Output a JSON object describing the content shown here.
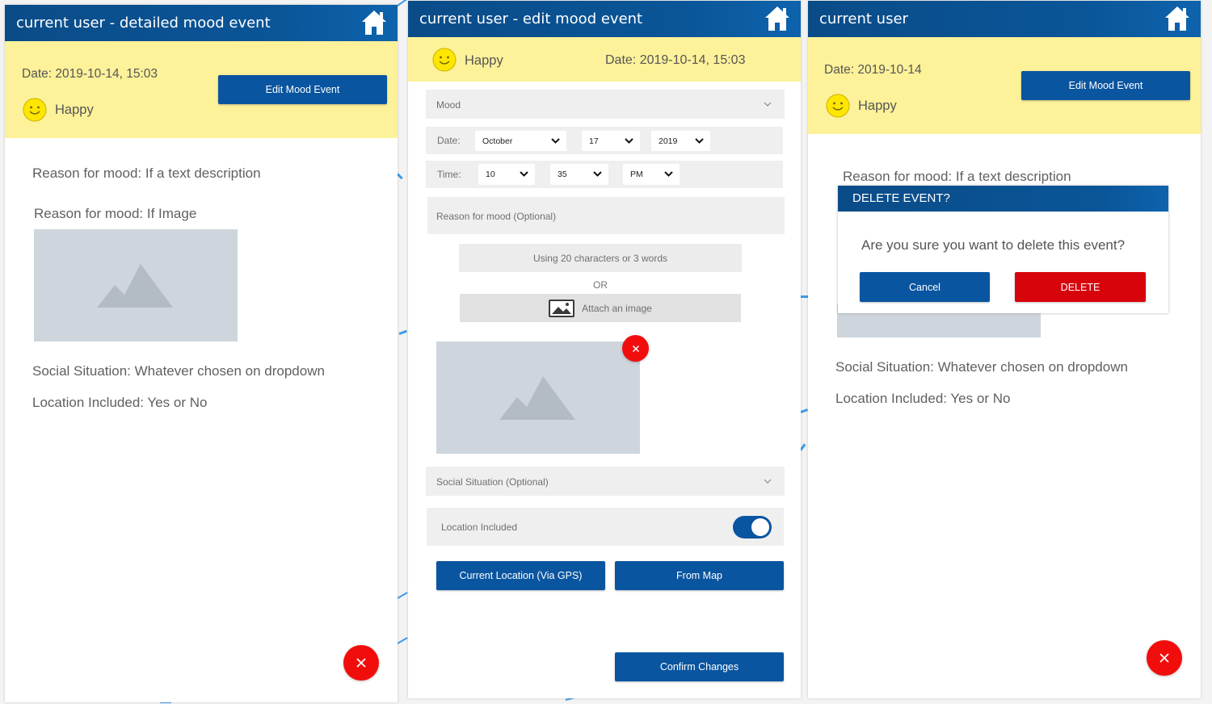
{
  "colors": {
    "header": "#0a5598",
    "accent": "#0a55a0",
    "danger": "#d8040c",
    "yellow": "#fdf199"
  },
  "panel1": {
    "title": "current user - detailed mood event",
    "date": "Date: 2019-10-14, 15:03",
    "edit_button": "Edit Mood Event",
    "mood": "Happy",
    "reason_text": "Reason for mood: If a text description",
    "reason_image": "Reason for mood: If Image",
    "social": "Social Situation: Whatever chosen on dropdown",
    "location": "Location Included: Yes or No",
    "close_icon": "close-icon"
  },
  "panel2": {
    "title": "current user - edit mood event",
    "mood": "Happy",
    "date": "Date: 2019-10-14, 15:03",
    "mood_select_placeholder": "Mood",
    "date_label": "Date:",
    "month": "October",
    "day": "17",
    "year": "2019",
    "time_label": "Time:",
    "hour": "10",
    "minute": "35",
    "ampm": "PM",
    "reason_placeholder": "Reason for mood (Optional)",
    "reason_hint": "Using 20 characters or 3 words",
    "or_text": "OR",
    "attach_image": "Attach an image",
    "remove_icon": "close-icon",
    "social_placeholder": "Social Situation (Optional)",
    "location_label": "Location Included",
    "location_toggle": "on",
    "gps_button": "Current Location (Via GPS)",
    "map_button": "From Map",
    "confirm_button": "Confirm Changes"
  },
  "panel3": {
    "title": "current user",
    "date": "Date: 2019-10-14",
    "edit_button": "Edit Mood Event",
    "mood": "Happy",
    "reason_text": "Reason for mood: If a text description",
    "social": "Social Situation: Whatever chosen on dropdown",
    "location": "Location Included: Yes or No",
    "dialog": {
      "title": "DELETE EVENT?",
      "message": "Are you sure you want to delete this event?",
      "cancel": "Cancel",
      "delete": "DELETE"
    }
  }
}
